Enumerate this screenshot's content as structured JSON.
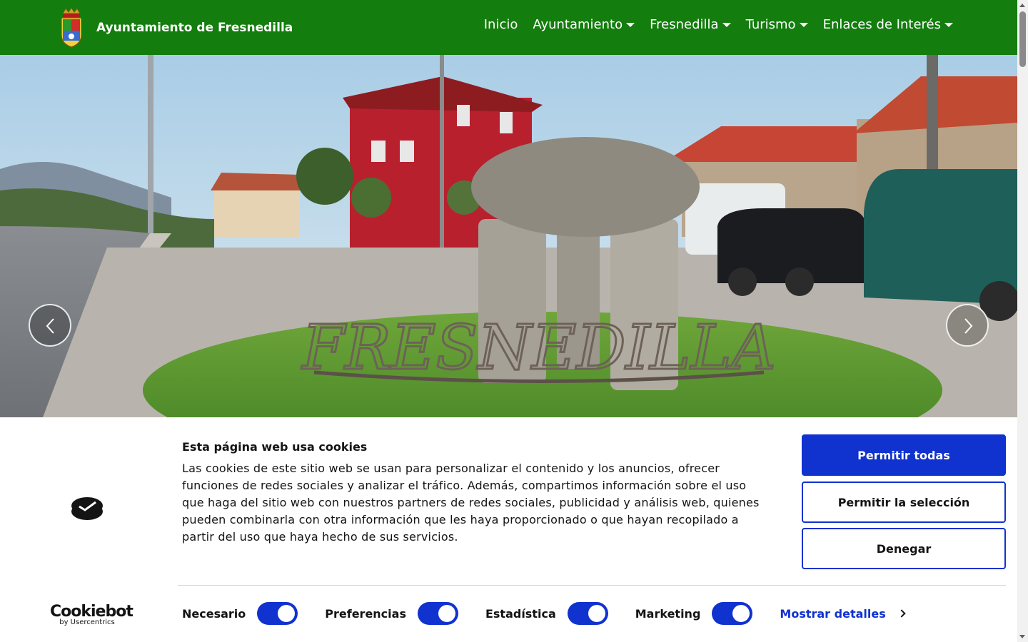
{
  "navbar": {
    "brand": "Ayuntamiento de Fresnedilla",
    "items": [
      {
        "label": "Inicio",
        "dropdown": false
      },
      {
        "label": "Ayuntamiento",
        "dropdown": true
      },
      {
        "label": "Fresnedilla",
        "dropdown": true
      },
      {
        "label": "Turismo",
        "dropdown": true
      },
      {
        "label": "Enlaces de Interés",
        "dropdown": true
      }
    ]
  },
  "hero": {
    "sign_text": "FRESNEDILLA",
    "prev_icon": "chevron-left-icon",
    "next_icon": "chevron-right-icon"
  },
  "cookie": {
    "title": "Esta página web usa cookies",
    "text": "Las cookies de este sitio web se usan para personalizar el contenido y los anuncios, ofrecer funciones de redes sociales y analizar el tráfico. Además, compartimos información sobre el uso que haga del sitio web con nuestros partners de redes sociales, publicidad y análisis web, quienes pueden combinarla con otra información que les haya proporcionado o que hayan recopilado a partir del uso que haya hecho de sus servicios.",
    "buttons": {
      "allow_all": "Permitir todas",
      "allow_selection": "Permitir la selección",
      "deny": "Denegar"
    },
    "logo": {
      "name": "Cookiebot",
      "sub": "by Usercentrics"
    },
    "toggles": [
      {
        "label": "Necesario",
        "on": true
      },
      {
        "label": "Preferencias",
        "on": true
      },
      {
        "label": "Estadística",
        "on": true
      },
      {
        "label": "Marketing",
        "on": true
      }
    ],
    "details_label": "Mostrar detalles"
  },
  "colors": {
    "navbar": "#137d0d",
    "accent": "#1032cf",
    "text": "#141414"
  }
}
